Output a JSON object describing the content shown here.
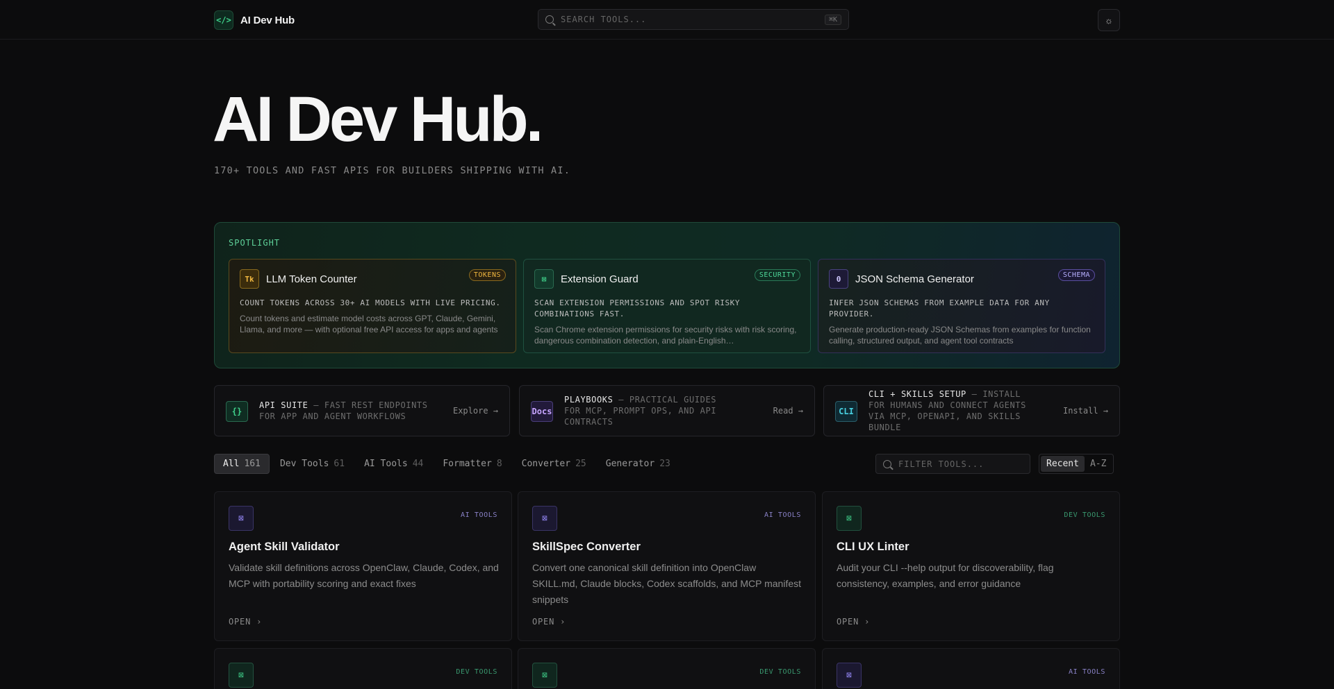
{
  "header": {
    "brand_icon": "</>",
    "brand_name": "AI Dev Hub",
    "search_placeholder": "SEARCH TOOLS...",
    "search_shortcut": "⌘K",
    "theme_icon": "sun-icon"
  },
  "hero": {
    "title": "AI Dev Hub.",
    "subtitle": "170+ TOOLS AND FAST APIS FOR BUILDERS SHIPPING WITH AI."
  },
  "spotlight": {
    "label": "SPOTLIGHT",
    "cards": [
      {
        "icon": "Tk",
        "title": "LLM Token Counter",
        "badge": "TOKENS",
        "tagline": "COUNT TOKENS ACROSS 30+ AI MODELS WITH LIVE PRICING.",
        "description": "Count tokens and estimate model costs across GPT, Claude, Gemini, Llama, and more — with optional free API access for apps and agents"
      },
      {
        "icon": "⊠",
        "title": "Extension Guard",
        "badge": "SECURITY",
        "tagline": "SCAN EXTENSION PERMISSIONS AND SPOT RISKY COMBINATIONS FAST.",
        "description": "Scan Chrome extension permissions for security risks with risk scoring, dangerous combination detection, and plain-English…"
      },
      {
        "icon": "0",
        "title": "JSON Schema Generator",
        "badge": "SCHEMA",
        "tagline": "INFER JSON SCHEMAS FROM EXAMPLE DATA FOR ANY PROVIDER.",
        "description": "Generate production-ready JSON Schemas from examples for function calling, structured output, and agent tool contracts"
      }
    ]
  },
  "nav_cards": [
    {
      "icon": "{}",
      "title": "API SUITE",
      "subtitle": "— FAST REST ENDPOINTS FOR APP AND AGENT WORKFLOWS",
      "action": "Explore →"
    },
    {
      "icon": "Docs",
      "title": "PLAYBOOKS",
      "subtitle": "— PRACTICAL GUIDES FOR MCP, PROMPT OPS, AND API CONTRACTS",
      "action": "Read →"
    },
    {
      "icon": "CLI",
      "title": "CLI + SKILLS SETUP",
      "subtitle": "— INSTALL FOR HUMANS AND CONNECT AGENTS VIA MCP, OPENAPI, AND SKILLS BUNDLE",
      "action": "Install →"
    }
  ],
  "filters": {
    "tabs": [
      {
        "label": "All",
        "count": "161"
      },
      {
        "label": "Dev Tools",
        "count": "61"
      },
      {
        "label": "AI Tools",
        "count": "44"
      },
      {
        "label": "Formatter",
        "count": "8"
      },
      {
        "label": "Converter",
        "count": "25"
      },
      {
        "label": "Generator",
        "count": "23"
      }
    ],
    "active_index": 0,
    "search_placeholder": "FILTER TOOLS...",
    "sort_options": [
      "Recent",
      "A-Z"
    ],
    "sort_active": 0
  },
  "tools": [
    {
      "category": "AI TOOLS",
      "kind": "ai",
      "title": "Agent Skill Validator",
      "description": "Validate skill definitions across OpenClaw, Claude, Codex, and MCP with portability scoring and exact fixes",
      "action": "OPEN"
    },
    {
      "category": "AI TOOLS",
      "kind": "ai",
      "title": "SkillSpec Converter",
      "description": "Convert one canonical skill definition into OpenClaw SKILL.md, Claude blocks, Codex scaffolds, and MCP manifest snippets",
      "action": "OPEN"
    },
    {
      "category": "DEV TOOLS",
      "kind": "dev",
      "title": "CLI UX Linter",
      "description": "Audit your CLI --help output for discoverability, flag consistency, examples, and error guidance",
      "action": "OPEN"
    },
    {
      "category": "DEV TOOLS",
      "kind": "dev",
      "title": "",
      "description": "",
      "action": ""
    },
    {
      "category": "DEV TOOLS",
      "kind": "dev",
      "title": "",
      "description": "",
      "action": ""
    },
    {
      "category": "AI TOOLS",
      "kind": "ai",
      "title": "",
      "description": "",
      "action": ""
    }
  ],
  "colors": {
    "background": "#0c0c0d",
    "accent_green": "#3fd08a",
    "accent_amber": "#f0b740",
    "accent_violet": "#9a8cff"
  }
}
